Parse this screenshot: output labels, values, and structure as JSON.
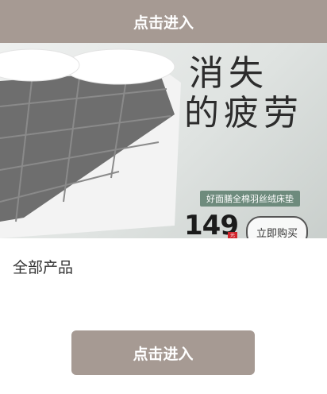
{
  "header": {
    "title": "点击进入"
  },
  "banner": {
    "title_line1": "消失",
    "title_line2": "的疲劳",
    "subtitle": "好面膳全棉羽丝绒床垫",
    "price": "149",
    "price_unit": "元",
    "buy_label": "立即购买"
  },
  "carousel": {
    "active_index": 0
  },
  "section": {
    "title": "全部产品"
  },
  "footer": {
    "enter_label": "点击进入"
  },
  "colors": {
    "accent": "#a69a93",
    "price_badge": "#d2252c",
    "subtitle_band": "#6e8b7d"
  }
}
